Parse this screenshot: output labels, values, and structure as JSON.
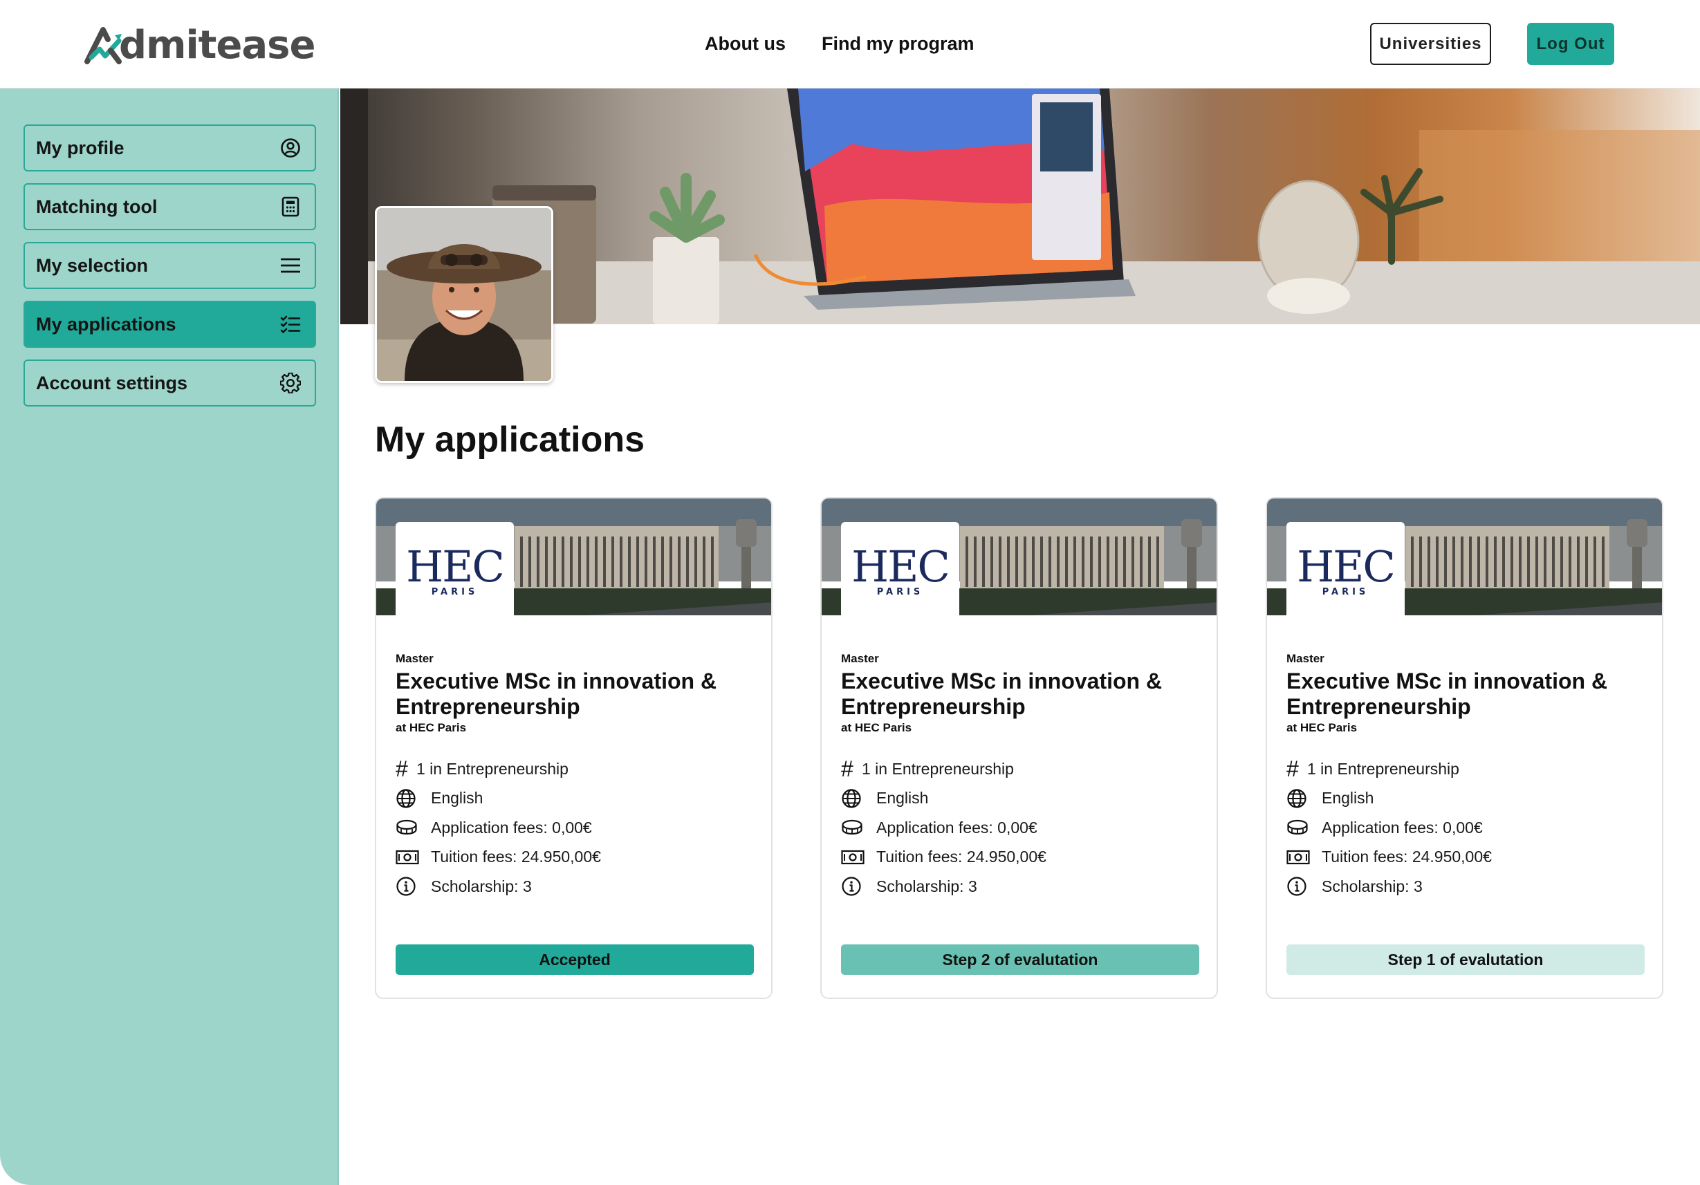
{
  "header": {
    "logo_text": "dmitease",
    "logo_full": "Admitease",
    "nav": [
      {
        "label": "About us"
      },
      {
        "label": "Find my program"
      }
    ],
    "universities_label": "Universities",
    "logout_label": "Log Out"
  },
  "sidebar": {
    "items": [
      {
        "label": "My profile",
        "icon": "user-circle-icon",
        "active": false
      },
      {
        "label": "Matching tool",
        "icon": "calculator-icon",
        "active": false
      },
      {
        "label": "My selection",
        "icon": "menu-lines-icon",
        "active": false
      },
      {
        "label": "My applications",
        "icon": "checklist-icon",
        "active": true
      },
      {
        "label": "Account settings",
        "icon": "gear-icon",
        "active": false
      }
    ]
  },
  "main": {
    "title": "My applications",
    "applications": [
      {
        "school_logo": "HEC",
        "school_logo_sub": "PARIS",
        "degree": "Master",
        "program": "Executive MSc in innovation & Entrepreneurship",
        "school": "at HEC Paris",
        "rank_prefix": "#",
        "rank": "1 in Entrepreneurship",
        "language": "English",
        "application_fees": "Application fees: 0,00€",
        "tuition_fees": "Tuition fees: 24.950,00€",
        "scholarship": "Scholarship: 3",
        "status": "Accepted",
        "status_color": "#21a999"
      },
      {
        "school_logo": "HEC",
        "school_logo_sub": "PARIS",
        "degree": "Master",
        "program": "Executive MSc in innovation & Entrepreneurship",
        "school": "at HEC Paris",
        "rank_prefix": "#",
        "rank": "1 in Entrepreneurship",
        "language": "English",
        "application_fees": "Application fees: 0,00€",
        "tuition_fees": "Tuition fees: 24.950,00€",
        "scholarship": "Scholarship: 3",
        "status": "Step 2 of evalutation",
        "status_color": "#68c1b2"
      },
      {
        "school_logo": "HEC",
        "school_logo_sub": "PARIS",
        "degree": "Master",
        "program": "Executive MSc in innovation & Entrepreneurship",
        "school": "at HEC Paris",
        "rank_prefix": "#",
        "rank": "1 in Entrepreneurship",
        "language": "English",
        "application_fees": "Application fees: 0,00€",
        "tuition_fees": "Tuition fees: 24.950,00€",
        "scholarship": "Scholarship: 3",
        "status": "Step 1 of evalutation",
        "status_color": "#d0ebe6"
      }
    ]
  },
  "colors": {
    "accent": "#21a999",
    "sidebar_bg": "#9dd5cb",
    "hec_navy": "#1b2a5c"
  }
}
